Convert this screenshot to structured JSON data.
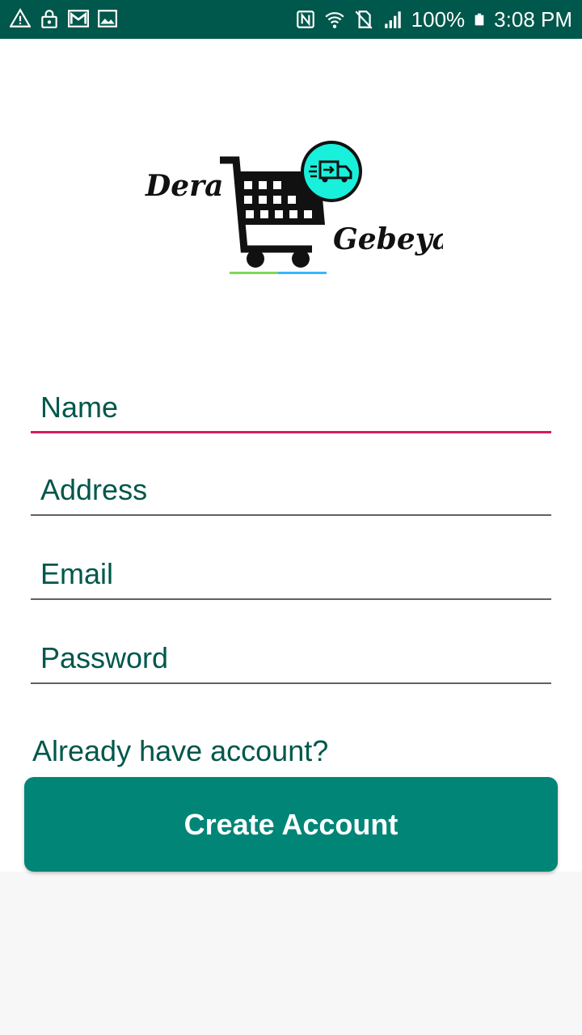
{
  "status_bar": {
    "battery": "100%",
    "time": "3:08 PM",
    "left_icons": [
      "warning-icon",
      "lock-icon",
      "gmail-icon",
      "image-icon"
    ],
    "right_icons": [
      "nfc-icon",
      "wifi-icon",
      "no-sim-icon",
      "signal-icon",
      "battery-icon"
    ]
  },
  "logo": {
    "word1": "Dera",
    "word2": "Gebeya"
  },
  "form": {
    "name_placeholder": "Name",
    "address_placeholder": "Address",
    "email_placeholder": "Email",
    "password_placeholder": "Password"
  },
  "login_link": "Already have account?",
  "create_button": "Create Account",
  "colors": {
    "status_bar": "#00574b",
    "primary": "#008577",
    "accent": "#d81b60",
    "text": "#00574b"
  }
}
